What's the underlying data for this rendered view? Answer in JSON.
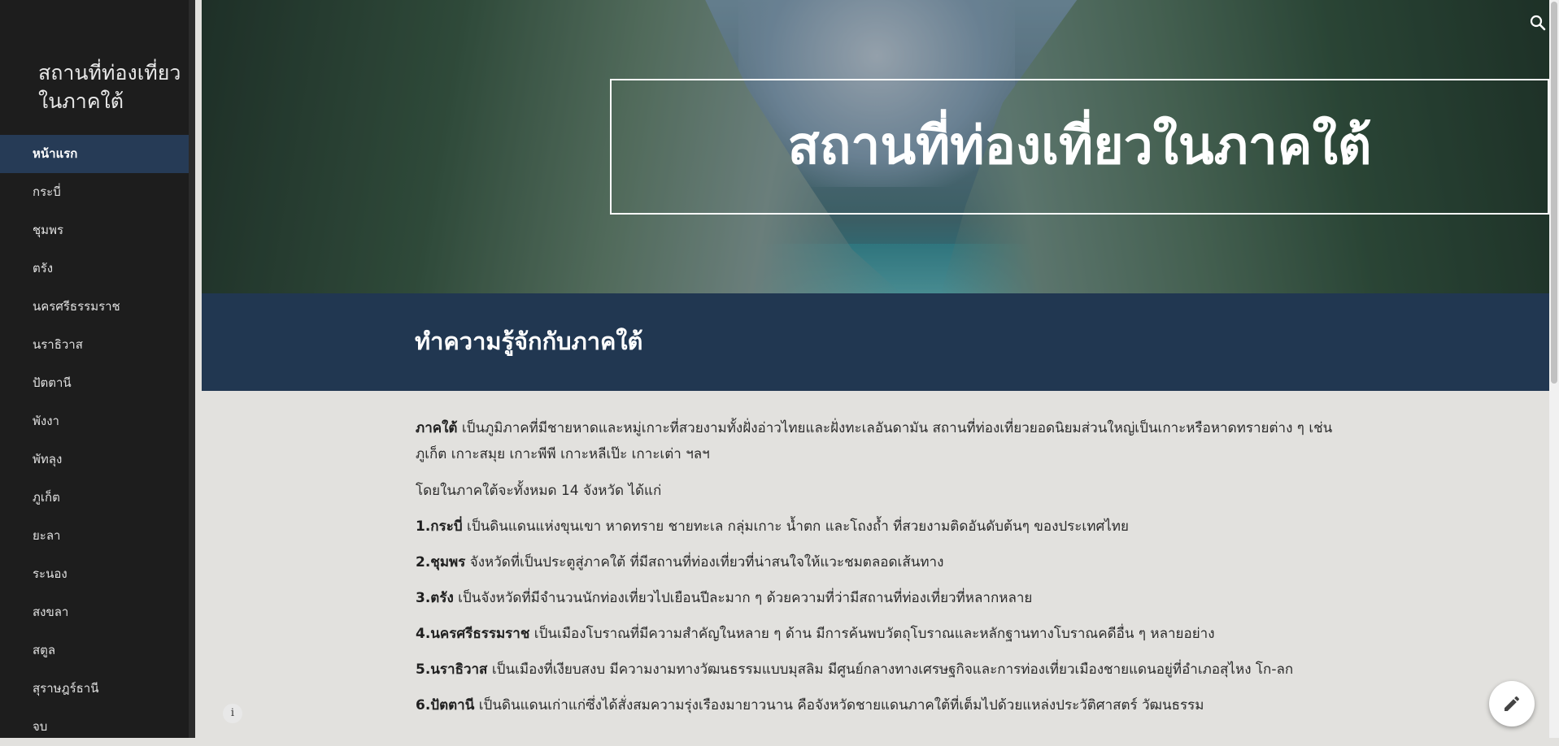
{
  "sidebar": {
    "site_title": "สถานที่ท่องเที่ยวในภาคใต้",
    "items": [
      {
        "label": "หน้าแรก",
        "active": true
      },
      {
        "label": "กระบี่"
      },
      {
        "label": "ชุมพร"
      },
      {
        "label": "ตรัง"
      },
      {
        "label": "นครศรีธรรมราช"
      },
      {
        "label": "นราธิวาส"
      },
      {
        "label": "ปัตตานี"
      },
      {
        "label": "พังงา"
      },
      {
        "label": "พัทลุง"
      },
      {
        "label": "ภูเก็ต"
      },
      {
        "label": "ยะลา"
      },
      {
        "label": "ระนอง"
      },
      {
        "label": "สงขลา"
      },
      {
        "label": "สตูล"
      },
      {
        "label": "สุราษฎร์ธานี"
      },
      {
        "label": "จบ"
      }
    ]
  },
  "hero": {
    "title": "สถานที่ท่องเที่ยวในภาคใต้"
  },
  "section": {
    "title": "ทำความรู้จักกับภาคใต้"
  },
  "content": {
    "intro_bold": "ภาคใต้",
    "intro_text": " เป็นภูมิภาคที่มีชายหาดและหมู่เกาะที่สวยงามทั้งฝั่งอ่าวไทยและฝั่งทะเลอันดามัน สถานที่ท่องเที่ยวยอดนิยมส่วนใหญ่เป็นเกาะหรือหาดทรายต่าง ๆ เช่น ภูเก็ต เกาะสมุย เกาะพีพี เกาะหลีเป๊ะ เกาะเต่า ฯลฯ",
    "count_text": "โดยในภาคใต้จะทั้งหมด 14 จังหวัด ได้แก่",
    "provinces": [
      {
        "name": "1.กระบี่",
        "desc": " เป็นดินแดนแห่งขุนเขา หาดทราย ชายทะเล กลุ่มเกาะ น้ำตก และโถงถ้ำ ที่สวยงามติดอันดับต้นๆ ของประเทศไทย"
      },
      {
        "name": "2.ชุมพร",
        "desc": " จังหวัดที่เป็นประตูสู่ภาคใต้ ที่มีสถานที่ท่องเที่ยวที่น่าสนใจให้แวะชมตลอดเส้นทาง"
      },
      {
        "name": "3.ตรัง",
        "desc": " เป็นจังหวัดที่มีจำนวนนักท่องเที่ยวไปเยือนปีละมาก ๆ ด้วยความที่ว่ามีสถานที่ท่องเที่ยวที่หลากหลาย"
      },
      {
        "name": "4.นครศรีธรรมราช",
        "desc": " เป็นเมืองโบราณที่มีความสำคัญในหลาย ๆ ด้าน มีการค้นพบวัตถุโบราณและหลักฐานทางโบราณคดีอื่น ๆ หลายอย่าง"
      },
      {
        "name": "5.นราธิวาส",
        "desc": " เป็นเมืองที่เงียบสงบ มีความงามทางวัฒนธรรมแบบมุสลิม มีศูนย์กลางทางเศรษฐกิจและการท่องเที่ยวเมืองชายแดนอยู่ที่อำเภอสุไหง โก-ลก"
      },
      {
        "name": "6.ปัตตานี",
        "desc": " เป็นดินแดนเก่าแก่ซึ่งได้สั่งสมความรุ่งเรืองมายาวนาน คือจังหวัดชายแดนภาคใต้ที่เต็มไปด้วยแหล่งประวัติศาสตร์ วัฒนธรรม"
      }
    ]
  },
  "icons": {
    "search": "search-icon",
    "info": "info-icon",
    "edit": "pencil-icon"
  },
  "colors": {
    "sidebar_bg": "#1d1d1d",
    "active_item": "#263b56",
    "band_bg": "#213751",
    "content_bg": "#e2e1de"
  }
}
